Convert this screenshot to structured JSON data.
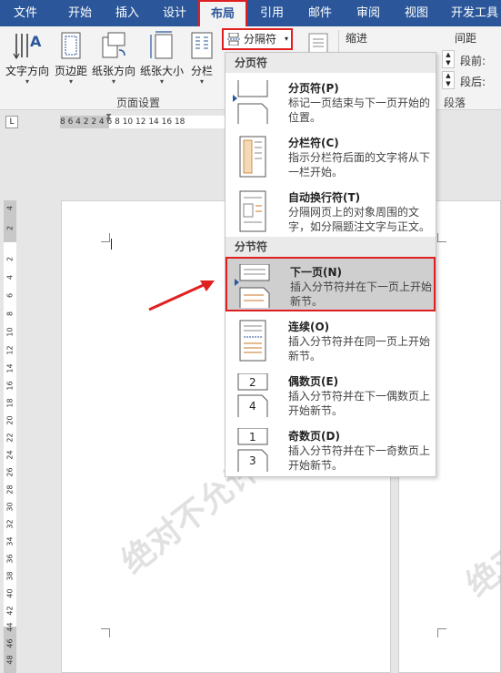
{
  "menubar": {
    "tabs": [
      {
        "label": "文件",
        "name": "tab-file"
      },
      {
        "label": "开始",
        "name": "tab-home"
      },
      {
        "label": "插入",
        "name": "tab-insert"
      },
      {
        "label": "设计",
        "name": "tab-design"
      },
      {
        "label": "布局",
        "name": "tab-layout",
        "active": true
      },
      {
        "label": "引用",
        "name": "tab-references"
      },
      {
        "label": "邮件",
        "name": "tab-mailings"
      },
      {
        "label": "审阅",
        "name": "tab-review"
      },
      {
        "label": "视图",
        "name": "tab-view"
      },
      {
        "label": "开发工具",
        "name": "tab-developer"
      }
    ]
  },
  "ribbon": {
    "text_direction": "文字方向",
    "margins": "页边距",
    "orientation": "纸张方向",
    "size": "纸张大小",
    "columns": "分栏",
    "breaks": "分隔符",
    "page_setup_group": "页面设置",
    "indent_label": "缩进",
    "spacing_label": "间距",
    "before_label": "段前:",
    "after_label": "段后:",
    "paragraph_group": "段落"
  },
  "ruler": {
    "corner_glyph": "L",
    "numbers": "8  6  4  2     2  4  6  8  10 12 14 16 18",
    "vertical_numbers": [
      "4",
      "2",
      "2",
      "4",
      "6",
      "8",
      "10",
      "12",
      "14",
      "16",
      "18",
      "20",
      "22",
      "24",
      "26",
      "28",
      "30",
      "32",
      "34",
      "36",
      "38",
      "40",
      "42",
      "44",
      "46",
      "48"
    ]
  },
  "watermark": "绝对不允许外传",
  "dropdown": {
    "page_breaks_header": "分页符",
    "section_breaks_header": "分节符",
    "items": [
      {
        "title": "分页符(P)",
        "desc": "标记一页结束与下一页开始的位置。"
      },
      {
        "title": "分栏符(C)",
        "desc": "指示分栏符后面的文字将从下一栏开始。"
      },
      {
        "title": "自动换行符(T)",
        "desc": "分隔网页上的对象周围的文字，如分隔题注文字与正文。"
      },
      {
        "title": "下一页(N)",
        "desc": "插入分节符并在下一页上开始新节。"
      },
      {
        "title": "连续(O)",
        "desc": "插入分节符并在同一页上开始新节。"
      },
      {
        "title": "偶数页(E)",
        "desc": "插入分节符并在下一偶数页上开始新节。"
      },
      {
        "title": "奇数页(D)",
        "desc": "插入分节符并在下一奇数页上开始新节。"
      }
    ]
  },
  "colors": {
    "accent": "#2b579a",
    "highlight_border": "#e02020",
    "arrow": "#e02020"
  }
}
